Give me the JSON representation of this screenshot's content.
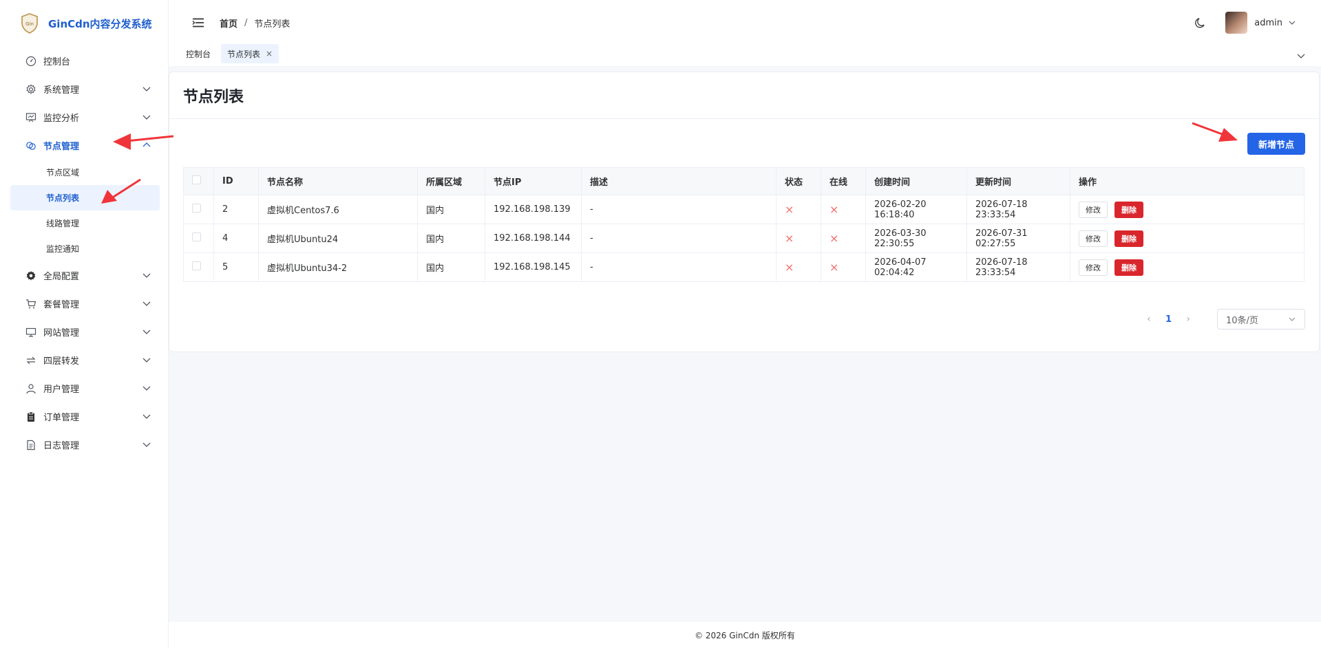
{
  "app": {
    "title": "GinCdn内容分发系统"
  },
  "sidebar": {
    "items": [
      {
        "label": "控制台",
        "icon": "dashboard-icon"
      },
      {
        "label": "系统管理",
        "icon": "gear-icon"
      },
      {
        "label": "监控分析",
        "icon": "monitor-chart-icon"
      },
      {
        "label": "节点管理",
        "icon": "node-link-icon"
      },
      {
        "label": "全局配置",
        "icon": "cog-filled-icon"
      },
      {
        "label": "套餐管理",
        "icon": "cart-icon"
      },
      {
        "label": "网站管理",
        "icon": "desktop-icon"
      },
      {
        "label": "四层转发",
        "icon": "forward-icon"
      },
      {
        "label": "用户管理",
        "icon": "user-icon"
      },
      {
        "label": "订单管理",
        "icon": "clipboard-icon"
      },
      {
        "label": "日志管理",
        "icon": "document-icon"
      }
    ],
    "node_submenu": [
      "节点区域",
      "节点列表",
      "线路管理",
      "监控通知"
    ]
  },
  "header": {
    "breadcrumb_home": "首页",
    "breadcrumb_sep": "/",
    "breadcrumb_current": "节点列表",
    "user_name": "admin"
  },
  "tabs": [
    {
      "label": "控制台"
    },
    {
      "label": "节点列表",
      "close": "×"
    }
  ],
  "page": {
    "title": "节点列表",
    "add_button": "新增节点"
  },
  "table": {
    "columns": [
      "ID",
      "节点名称",
      "所属区域",
      "节点IP",
      "描述",
      "状态",
      "在线",
      "创建时间",
      "更新时间",
      "操作"
    ],
    "rows": [
      {
        "id": "2",
        "name": "虚拟机Centos7.6",
        "region": "国内",
        "ip": "192.168.198.139",
        "desc": "-",
        "status": "×",
        "online": "×",
        "created": "2026-02-20 16:18:40",
        "updated": "2026-07-18 23:33:54"
      },
      {
        "id": "4",
        "name": "虚拟机Ubuntu24",
        "region": "国内",
        "ip": "192.168.198.144",
        "desc": "-",
        "status": "×",
        "online": "×",
        "created": "2026-03-30 22:30:55",
        "updated": "2026-07-31 02:27:55"
      },
      {
        "id": "5",
        "name": "虚拟机Ubuntu34-2",
        "region": "国内",
        "ip": "192.168.198.145",
        "desc": "-",
        "status": "×",
        "online": "×",
        "created": "2026-04-07 02:04:42",
        "updated": "2026-07-18 23:33:54"
      }
    ],
    "edit_label": "修改",
    "delete_label": "删除"
  },
  "pagination": {
    "prev": "‹",
    "current": "1",
    "next": "›",
    "page_size": "10条/页"
  },
  "footer": {
    "text": "© 2026 GinCdn 版权所有"
  },
  "colors": {
    "accent": "#2464e6",
    "danger": "#d9262c",
    "status_x": "#f56c6c",
    "annotation_arrow": "#f0353a"
  }
}
